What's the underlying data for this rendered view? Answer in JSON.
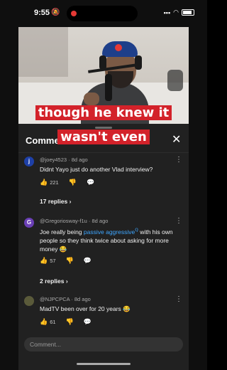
{
  "status_bar": {
    "time": "9:55",
    "bell": "🔕",
    "signal": "▪▪▪",
    "wifi": "◠"
  },
  "video": {
    "caption_line_1": "though he knew it",
    "caption_line_2": "wasn't even"
  },
  "comments_panel": {
    "title": "Comments",
    "close": "✕",
    "comments": [
      {
        "avatar_letter": "j",
        "avatar_color": "#1e40a8",
        "meta": "@joey4523 · 8d ago",
        "text": "Didnt Yayo just do another Vlad interview?",
        "likes": "221",
        "replies": "17 replies"
      },
      {
        "avatar_letter": "G",
        "avatar_color": "#6a3fb5",
        "meta": "@Gregoriosway-f1u · 8d ago",
        "text_before": "Joe really being ",
        "text_link": "passive aggressive",
        "text_link_mark": "ℚ",
        "text_after": " with his own people so they think twice about asking for more money 😂",
        "likes": "57",
        "replies": "2 replies"
      },
      {
        "avatar_letter": "",
        "avatar_color": "#5a5a3a",
        "meta": "@NJPCPCA · 8d ago",
        "text": "MadTV been over for 20 years 😂",
        "likes": "61"
      }
    ],
    "input_placeholder": "Comment..."
  },
  "icons": {
    "like": "👍",
    "dislike": "👎",
    "reply": "💬",
    "more": "⋮",
    "chevron": "›"
  }
}
